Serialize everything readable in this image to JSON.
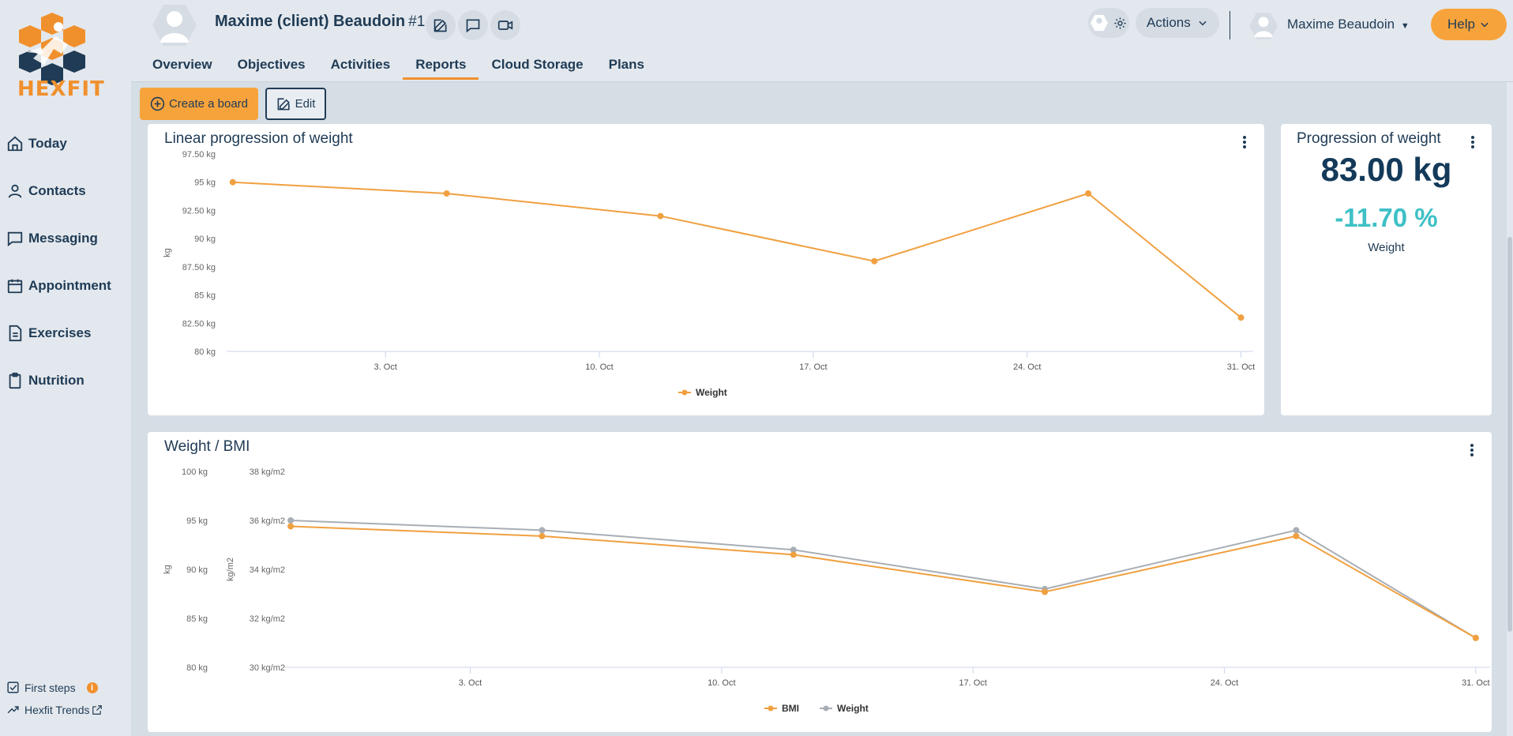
{
  "brand": {
    "name": "HEXFIT",
    "color": "#f0902d"
  },
  "sidebar": {
    "items": [
      {
        "label": "Today",
        "icon": "home-icon"
      },
      {
        "label": "Contacts",
        "icon": "user-icon"
      },
      {
        "label": "Messaging",
        "icon": "chat-icon"
      },
      {
        "label": "Appointment",
        "icon": "calendar-icon"
      },
      {
        "label": "Exercises",
        "icon": "document-icon"
      },
      {
        "label": "Nutrition",
        "icon": "clipboard-icon"
      }
    ],
    "footer": {
      "first_steps": "First steps",
      "first_steps_badge": "i",
      "trends": "Hexfit Trends"
    }
  },
  "header": {
    "client_name": "Maxime (client) Beaudoin",
    "client_id": "#1",
    "tabs": [
      {
        "label": "Overview"
      },
      {
        "label": "Objectives"
      },
      {
        "label": "Activities"
      },
      {
        "label": "Reports",
        "active": true
      },
      {
        "label": "Cloud Storage"
      },
      {
        "label": "Plans"
      }
    ],
    "actions_label": "Actions",
    "user_name": "Maxime Beaudoin",
    "help_label": "Help"
  },
  "toolbar": {
    "create_label": "Create a board",
    "edit_label": "Edit"
  },
  "weight_card": {
    "title": "Progression of weight",
    "value": "83.00 kg",
    "change": "-11.70 %",
    "label": "Weight",
    "change_color": "#3ec0c6"
  },
  "chart_data": [
    {
      "type": "line",
      "title": "Linear progression of weight",
      "ylabel": "kg",
      "ylim": [
        80,
        97.5
      ],
      "y_ticks": [
        "97.50 kg",
        "95 kg",
        "92.50 kg",
        "90 kg",
        "87.50 kg",
        "85 kg",
        "82.50 kg",
        "80 kg"
      ],
      "y_tick_values": [
        97.5,
        95,
        92.5,
        90,
        87.5,
        85,
        82.5,
        80
      ],
      "x_ticks": [
        "3. Oct",
        "10. Oct",
        "17. Oct",
        "24. Oct",
        "31. Oct"
      ],
      "x_tick_days": [
        3,
        10,
        17,
        24,
        31
      ],
      "xlim_days": [
        -2.2,
        31.4
      ],
      "series": [
        {
          "name": "Weight",
          "color": "#f0a040",
          "x_days": [
            -2,
            5,
            12,
            19,
            26,
            31
          ],
          "values": [
            95,
            94,
            92,
            88,
            94,
            83
          ]
        }
      ],
      "legend": "bottom-center"
    },
    {
      "type": "line",
      "title": "Weight / BMI",
      "ylabel_left": "kg",
      "ylabel_right": "kg/m2",
      "ylim_left": [
        80,
        100
      ],
      "ylim_right": [
        30,
        38
      ],
      "y_ticks_left": [
        "100 kg",
        "95 kg",
        "90 kg",
        "85 kg",
        "80 kg"
      ],
      "y_tick_values_left": [
        100,
        95,
        90,
        85,
        80
      ],
      "y_ticks_right": [
        "38 kg/m2",
        "36 kg/m2",
        "34 kg/m2",
        "32 kg/m2",
        "30 kg/m2"
      ],
      "x_ticks": [
        "3. Oct",
        "10. Oct",
        "17. Oct",
        "24. Oct",
        "31. Oct"
      ],
      "x_tick_days": [
        3,
        10,
        17,
        24,
        31
      ],
      "xlim_days": [
        -2.2,
        31.4
      ],
      "series": [
        {
          "name": "BMI",
          "color": "#f0a040",
          "x_days": [
            -2,
            5,
            12,
            19,
            26,
            31
          ],
          "values": [
            94.4,
            93.4,
            91.5,
            87.7,
            93.4,
            83.0
          ]
        },
        {
          "name": "Weight",
          "color": "#a8aeb5",
          "x_days": [
            -2,
            5,
            12,
            19,
            26,
            31
          ],
          "values": [
            95,
            94,
            92,
            88,
            94,
            83
          ]
        }
      ],
      "legend": "bottom-center"
    }
  ]
}
